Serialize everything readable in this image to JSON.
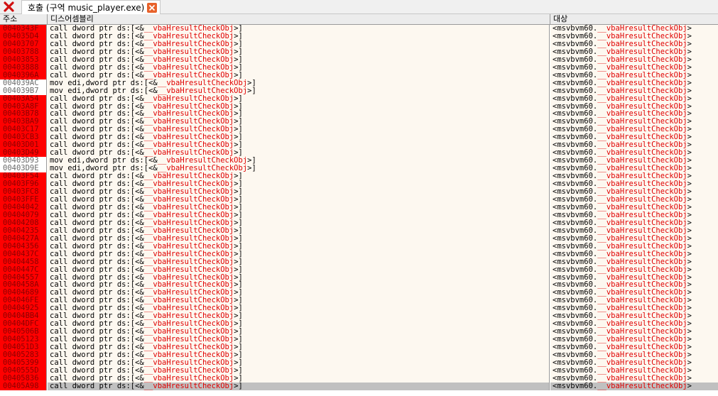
{
  "toolbar": {
    "close_icon": "close-x-icon"
  },
  "tab": {
    "title": "호출 (구역 music_player.exe)",
    "close_icon": "close-icon"
  },
  "columns": {
    "address": "주소",
    "disassembly": "디스어셈블리",
    "target": "대상"
  },
  "colors": {
    "highlight": "#ff0000",
    "function_name": "#e00000",
    "row_bg": "#fdf8f0",
    "selected_row": "#c0c0c0"
  },
  "rows": [
    {
      "address": "0040343F",
      "op": "call dword ptr ds:[<&",
      "sym": "__vbaHresultCheckObj",
      "tail": ">]",
      "target_pre": "<msvbvm60.",
      "target_sym": "__vbaHresultCheckObj",
      "target_post": ">",
      "highlight": true
    },
    {
      "address": "004035D4",
      "op": "call dword ptr ds:[<&",
      "sym": "__vbaHresultCheckObj",
      "tail": ">]",
      "target_pre": "<msvbvm60.",
      "target_sym": "__vbaHresultCheckObj",
      "target_post": ">",
      "highlight": true
    },
    {
      "address": "00403707",
      "op": "call dword ptr ds:[<&",
      "sym": "__vbaHresultCheckObj",
      "tail": ">]",
      "target_pre": "<msvbvm60.",
      "target_sym": "__vbaHresultCheckObj",
      "target_post": ">",
      "highlight": true
    },
    {
      "address": "00403788",
      "op": "call dword ptr ds:[<&",
      "sym": "__vbaHresultCheckObj",
      "tail": ">]",
      "target_pre": "<msvbvm60.",
      "target_sym": "__vbaHresultCheckObj",
      "target_post": ">",
      "highlight": true
    },
    {
      "address": "00403853",
      "op": "call dword ptr ds:[<&",
      "sym": "__vbaHresultCheckObj",
      "tail": ">]",
      "target_pre": "<msvbvm60.",
      "target_sym": "__vbaHresultCheckObj",
      "target_post": ">",
      "highlight": true
    },
    {
      "address": "00403888",
      "op": "call dword ptr ds:[<&",
      "sym": "__vbaHresultCheckObj",
      "tail": ">]",
      "target_pre": "<msvbvm60.",
      "target_sym": "__vbaHresultCheckObj",
      "target_post": ">",
      "highlight": true
    },
    {
      "address": "0040396A",
      "op": "call dword ptr ds:[<&",
      "sym": "__vbaHresultCheckObj",
      "tail": ">]",
      "target_pre": "<msvbvm60.",
      "target_sym": "__vbaHresultCheckObj",
      "target_post": ">",
      "highlight": true
    },
    {
      "address": "004039AC",
      "op": "mov edi,dword ptr ds:[<&",
      "sym": "__vbaHresultCheckObj",
      "tail": ">]",
      "target_pre": "<msvbvm60.",
      "target_sym": "__vbaHresultCheckObj",
      "target_post": ">",
      "highlight": false
    },
    {
      "address": "004039B7",
      "op": "mov edi,dword ptr ds:[<&",
      "sym": "__vbaHresultCheckObj",
      "tail": ">]",
      "target_pre": "<msvbvm60.",
      "target_sym": "__vbaHresultCheckObj",
      "target_post": ">",
      "highlight": false
    },
    {
      "address": "00403A54",
      "op": "call dword ptr ds:[<&",
      "sym": "__vbaHresultCheckObj",
      "tail": ">]",
      "target_pre": "<msvbvm60.",
      "target_sym": "__vbaHresultCheckObj",
      "target_post": ">",
      "highlight": true
    },
    {
      "address": "00403A8F",
      "op": "call dword ptr ds:[<&",
      "sym": "__vbaHresultCheckObj",
      "tail": ">]",
      "target_pre": "<msvbvm60.",
      "target_sym": "__vbaHresultCheckObj",
      "target_post": ">",
      "highlight": true
    },
    {
      "address": "00403B78",
      "op": "call dword ptr ds:[<&",
      "sym": "__vbaHresultCheckObj",
      "tail": ">]",
      "target_pre": "<msvbvm60.",
      "target_sym": "__vbaHresultCheckObj",
      "target_post": ">",
      "highlight": true
    },
    {
      "address": "00403BA9",
      "op": "call dword ptr ds:[<&",
      "sym": "__vbaHresultCheckObj",
      "tail": ">]",
      "target_pre": "<msvbvm60.",
      "target_sym": "__vbaHresultCheckObj",
      "target_post": ">",
      "highlight": true
    },
    {
      "address": "00403C17",
      "op": "call dword ptr ds:[<&",
      "sym": "__vbaHresultCheckObj",
      "tail": ">]",
      "target_pre": "<msvbvm60.",
      "target_sym": "__vbaHresultCheckObj",
      "target_post": ">",
      "highlight": true
    },
    {
      "address": "00403CB3",
      "op": "call dword ptr ds:[<&",
      "sym": "__vbaHresultCheckObj",
      "tail": ">]",
      "target_pre": "<msvbvm60.",
      "target_sym": "__vbaHresultCheckObj",
      "target_post": ">",
      "highlight": true
    },
    {
      "address": "00403D01",
      "op": "call dword ptr ds:[<&",
      "sym": "__vbaHresultCheckObj",
      "tail": ">]",
      "target_pre": "<msvbvm60.",
      "target_sym": "__vbaHresultCheckObj",
      "target_post": ">",
      "highlight": true
    },
    {
      "address": "00403D49",
      "op": "call dword ptr ds:[<&",
      "sym": "__vbaHresultCheckObj",
      "tail": ">]",
      "target_pre": "<msvbvm60.",
      "target_sym": "__vbaHresultCheckObj",
      "target_post": ">",
      "highlight": true
    },
    {
      "address": "00403D93",
      "op": "mov edi,dword ptr ds:[<&",
      "sym": "__vbaHresultCheckObj",
      "tail": ">]",
      "target_pre": "<msvbvm60.",
      "target_sym": "__vbaHresultCheckObj",
      "target_post": ">",
      "highlight": false
    },
    {
      "address": "00403D9E",
      "op": "mov edi,dword ptr ds:[<&",
      "sym": "__vbaHresultCheckObj",
      "tail": ">]",
      "target_pre": "<msvbvm60.",
      "target_sym": "__vbaHresultCheckObj",
      "target_post": ">",
      "highlight": false
    },
    {
      "address": "00403F54",
      "op": "call dword ptr ds:[<&",
      "sym": "__vbaHresultCheckObj",
      "tail": ">]",
      "target_pre": "<msvbvm60.",
      "target_sym": "__vbaHresultCheckObj",
      "target_post": ">",
      "highlight": true
    },
    {
      "address": "00403F96",
      "op": "call dword ptr ds:[<&",
      "sym": "__vbaHresultCheckObj",
      "tail": ">]",
      "target_pre": "<msvbvm60.",
      "target_sym": "__vbaHresultCheckObj",
      "target_post": ">",
      "highlight": true
    },
    {
      "address": "00403FC8",
      "op": "call dword ptr ds:[<&",
      "sym": "__vbaHresultCheckObj",
      "tail": ">]",
      "target_pre": "<msvbvm60.",
      "target_sym": "__vbaHresultCheckObj",
      "target_post": ">",
      "highlight": true
    },
    {
      "address": "00403FFE",
      "op": "call dword ptr ds:[<&",
      "sym": "__vbaHresultCheckObj",
      "tail": ">]",
      "target_pre": "<msvbvm60.",
      "target_sym": "__vbaHresultCheckObj",
      "target_post": ">",
      "highlight": true
    },
    {
      "address": "00404042",
      "op": "call dword ptr ds:[<&",
      "sym": "__vbaHresultCheckObj",
      "tail": ">]",
      "target_pre": "<msvbvm60.",
      "target_sym": "__vbaHresultCheckObj",
      "target_post": ">",
      "highlight": true
    },
    {
      "address": "00404079",
      "op": "call dword ptr ds:[<&",
      "sym": "__vbaHresultCheckObj",
      "tail": ">]",
      "target_pre": "<msvbvm60.",
      "target_sym": "__vbaHresultCheckObj",
      "target_post": ">",
      "highlight": true
    },
    {
      "address": "00404208",
      "op": "call dword ptr ds:[<&",
      "sym": "__vbaHresultCheckObj",
      "tail": ">]",
      "target_pre": "<msvbvm60.",
      "target_sym": "__vbaHresultCheckObj",
      "target_post": ">",
      "highlight": true
    },
    {
      "address": "00404235",
      "op": "call dword ptr ds:[<&",
      "sym": "__vbaHresultCheckObj",
      "tail": ">]",
      "target_pre": "<msvbvm60.",
      "target_sym": "__vbaHresultCheckObj",
      "target_post": ">",
      "highlight": true
    },
    {
      "address": "0040427A",
      "op": "call dword ptr ds:[<&",
      "sym": "__vbaHresultCheckObj",
      "tail": ">]",
      "target_pre": "<msvbvm60.",
      "target_sym": "__vbaHresultCheckObj",
      "target_post": ">",
      "highlight": true
    },
    {
      "address": "00404356",
      "op": "call dword ptr ds:[<&",
      "sym": "__vbaHresultCheckObj",
      "tail": ">]",
      "target_pre": "<msvbvm60.",
      "target_sym": "__vbaHresultCheckObj",
      "target_post": ">",
      "highlight": true
    },
    {
      "address": "0040437C",
      "op": "call dword ptr ds:[<&",
      "sym": "__vbaHresultCheckObj",
      "tail": ">]",
      "target_pre": "<msvbvm60.",
      "target_sym": "__vbaHresultCheckObj",
      "target_post": ">",
      "highlight": true
    },
    {
      "address": "00404458",
      "op": "call dword ptr ds:[<&",
      "sym": "__vbaHresultCheckObj",
      "tail": ">]",
      "target_pre": "<msvbvm60.",
      "target_sym": "__vbaHresultCheckObj",
      "target_post": ">",
      "highlight": true
    },
    {
      "address": "0040447C",
      "op": "call dword ptr ds:[<&",
      "sym": "__vbaHresultCheckObj",
      "tail": ">]",
      "target_pre": "<msvbvm60.",
      "target_sym": "__vbaHresultCheckObj",
      "target_post": ">",
      "highlight": true
    },
    {
      "address": "00404557",
      "op": "call dword ptr ds:[<&",
      "sym": "__vbaHresultCheckObj",
      "tail": ">]",
      "target_pre": "<msvbvm60.",
      "target_sym": "__vbaHresultCheckObj",
      "target_post": ">",
      "highlight": true
    },
    {
      "address": "0040458A",
      "op": "call dword ptr ds:[<&",
      "sym": "__vbaHresultCheckObj",
      "tail": ">]",
      "target_pre": "<msvbvm60.",
      "target_sym": "__vbaHresultCheckObj",
      "target_post": ">",
      "highlight": true
    },
    {
      "address": "00404689",
      "op": "call dword ptr ds:[<&",
      "sym": "__vbaHresultCheckObj",
      "tail": ">]",
      "target_pre": "<msvbvm60.",
      "target_sym": "__vbaHresultCheckObj",
      "target_post": ">",
      "highlight": true
    },
    {
      "address": "004046FE",
      "op": "call dword ptr ds:[<&",
      "sym": "__vbaHresultCheckObj",
      "tail": ">]",
      "target_pre": "<msvbvm60.",
      "target_sym": "__vbaHresultCheckObj",
      "target_post": ">",
      "highlight": true
    },
    {
      "address": "00404925",
      "op": "call dword ptr ds:[<&",
      "sym": "__vbaHresultCheckObj",
      "tail": ">]",
      "target_pre": "<msvbvm60.",
      "target_sym": "__vbaHresultCheckObj",
      "target_post": ">",
      "highlight": true
    },
    {
      "address": "00404BB4",
      "op": "call dword ptr ds:[<&",
      "sym": "__vbaHresultCheckObj",
      "tail": ">]",
      "target_pre": "<msvbvm60.",
      "target_sym": "__vbaHresultCheckObj",
      "target_post": ">",
      "highlight": true
    },
    {
      "address": "00404DFC",
      "op": "call dword ptr ds:[<&",
      "sym": "__vbaHresultCheckObj",
      "tail": ">]",
      "target_pre": "<msvbvm60.",
      "target_sym": "__vbaHresultCheckObj",
      "target_post": ">",
      "highlight": true
    },
    {
      "address": "0040506B",
      "op": "call dword ptr ds:[<&",
      "sym": "__vbaHresultCheckObj",
      "tail": ">]",
      "target_pre": "<msvbvm60.",
      "target_sym": "__vbaHresultCheckObj",
      "target_post": ">",
      "highlight": true
    },
    {
      "address": "00405123",
      "op": "call dword ptr ds:[<&",
      "sym": "__vbaHresultCheckObj",
      "tail": ">]",
      "target_pre": "<msvbvm60.",
      "target_sym": "__vbaHresultCheckObj",
      "target_post": ">",
      "highlight": true
    },
    {
      "address": "004051D3",
      "op": "call dword ptr ds:[<&",
      "sym": "__vbaHresultCheckObj",
      "tail": ">]",
      "target_pre": "<msvbvm60.",
      "target_sym": "__vbaHresultCheckObj",
      "target_post": ">",
      "highlight": true
    },
    {
      "address": "00405283",
      "op": "call dword ptr ds:[<&",
      "sym": "__vbaHresultCheckObj",
      "tail": ">]",
      "target_pre": "<msvbvm60.",
      "target_sym": "__vbaHresultCheckObj",
      "target_post": ">",
      "highlight": true
    },
    {
      "address": "00405399",
      "op": "call dword ptr ds:[<&",
      "sym": "__vbaHresultCheckObj",
      "tail": ">]",
      "target_pre": "<msvbvm60.",
      "target_sym": "__vbaHresultCheckObj",
      "target_post": ">",
      "highlight": true
    },
    {
      "address": "0040555D",
      "op": "call dword ptr ds:[<&",
      "sym": "__vbaHresultCheckObj",
      "tail": ">]",
      "target_pre": "<msvbvm60.",
      "target_sym": "__vbaHresultCheckObj",
      "target_post": ">",
      "highlight": true
    },
    {
      "address": "00405836",
      "op": "call dword ptr ds:[<&",
      "sym": "__vbaHresultCheckObj",
      "tail": ">]",
      "target_pre": "<msvbvm60.",
      "target_sym": "__vbaHresultCheckObj",
      "target_post": ">",
      "highlight": true
    },
    {
      "address": "00405A98",
      "op": "call dword ptr ds:[<&",
      "sym": "__vbaHresultCheckObj",
      "tail": ">]",
      "target_pre": "<msvbvm60.",
      "target_sym": "__vbaHresultCheckObj",
      "target_post": ">",
      "highlight": true,
      "selected": true
    }
  ]
}
